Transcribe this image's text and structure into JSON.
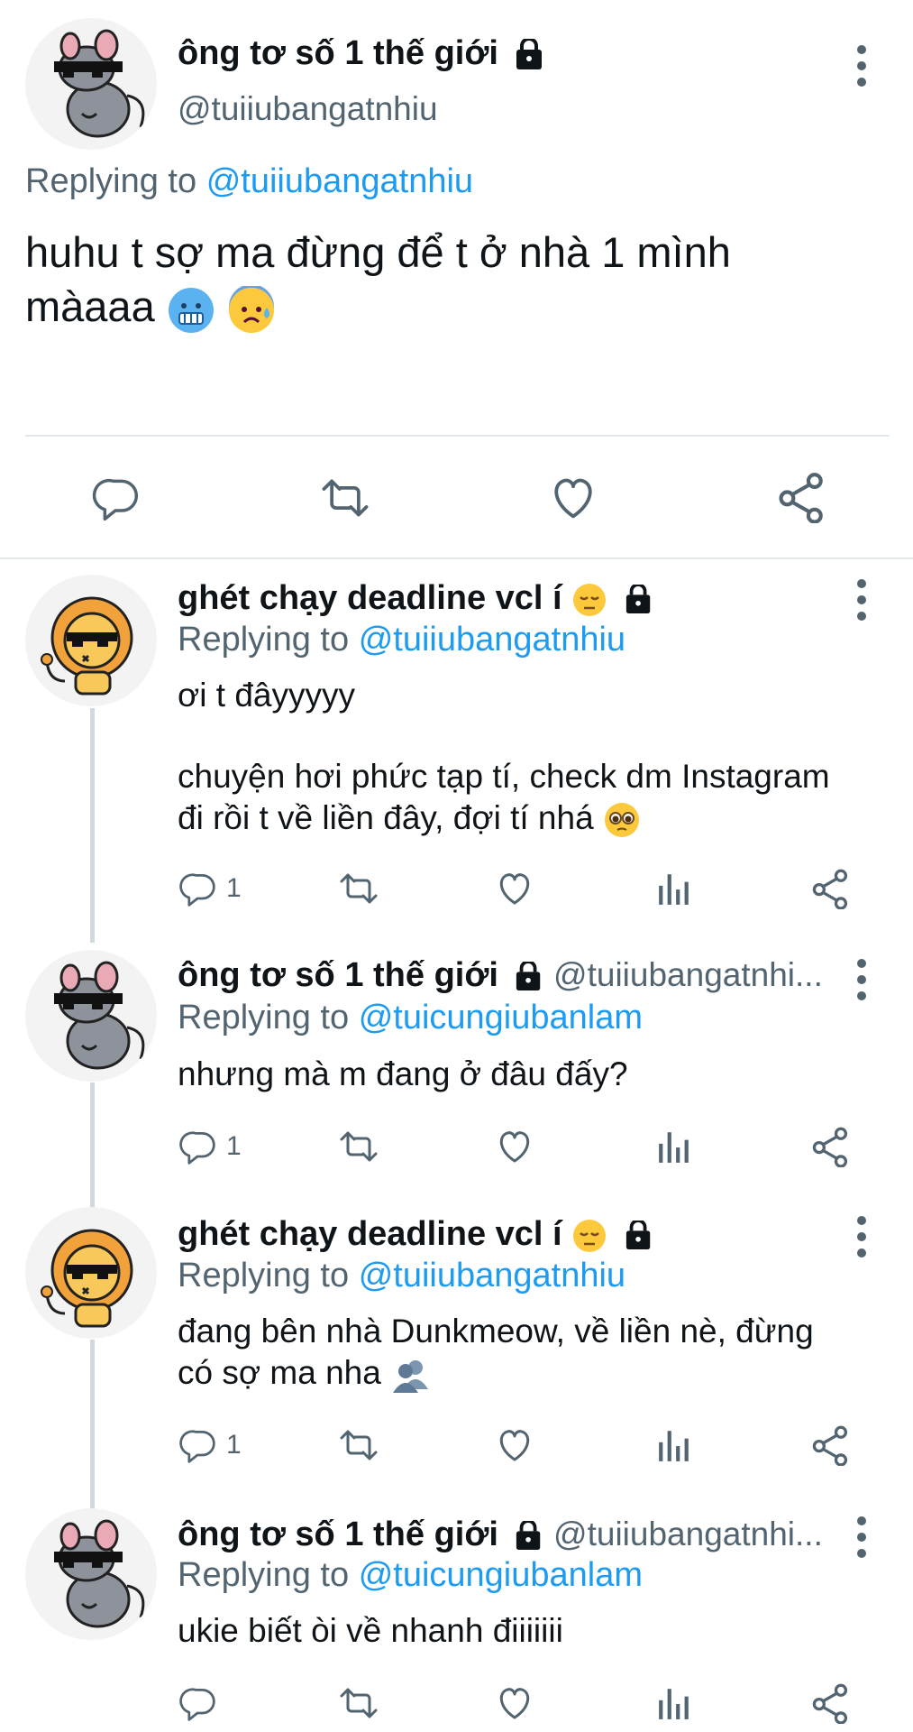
{
  "main_tweet": {
    "display_name": "ông tơ số 1 thế giới",
    "handle": "@tuiiubangatnhiu",
    "replying_prefix": "Replying to",
    "replying_to": "@tuiiubangatnhiu",
    "text_line1": "huhu t sợ ma đừng để t ở nhà 1 mình",
    "text_line2": "màaaa",
    "emojis": [
      "cold-face",
      "anxious-face-with-sweat"
    ]
  },
  "replies": [
    {
      "display_name": "ghét chạy deadline vcl í",
      "replying_prefix": "Replying to",
      "replying_to": "@tuiiubangatnhiu",
      "line1": "ơi t đâyyyyy",
      "line2": "chuyện hơi phức tạp tí, check dm Instagram",
      "line3": "đi rồi t về liền đây, đợi tí nhá",
      "reply_count": "1"
    },
    {
      "display_name": "ông tơ số 1 thế giới",
      "handle": "@tuiiubangatnhi...",
      "replying_prefix": "Replying to",
      "replying_to": "@tuicungiubanlam",
      "line1": "nhưng mà m đang ở đâu đấy?",
      "reply_count": "1"
    },
    {
      "display_name": "ghét chạy deadline vcl í",
      "replying_prefix": "Replying to",
      "replying_to": "@tuiiubangatnhiu",
      "line1": "đang bên nhà Dunkmeow, về liền nè, đừng",
      "line2": "có sợ ma nha",
      "reply_count": "1"
    },
    {
      "display_name": "ông tơ số 1 thế giới",
      "handle": "@tuiiubangatnhi...",
      "replying_prefix": "Replying to",
      "replying_to": "@tuicungiubanlam",
      "line1": "ukie biết òi về nhanh điiiiiii"
    }
  ],
  "colors": {
    "link": "#1d9bf0",
    "muted": "#536471",
    "divider": "#cfd9de"
  }
}
